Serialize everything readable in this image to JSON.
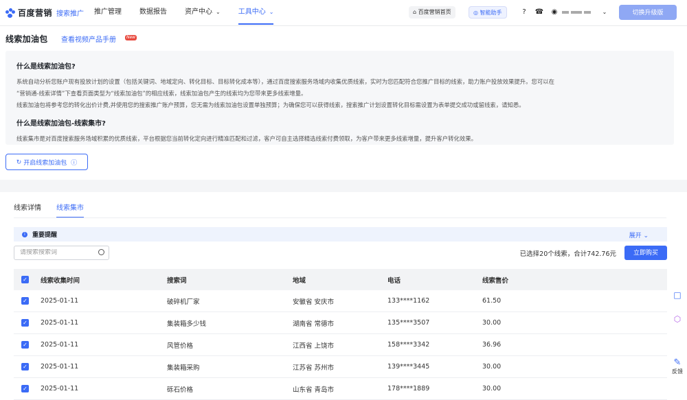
{
  "app": {
    "logo_text": "百度营销",
    "logo_sub": "搜索推广"
  },
  "nav": {
    "items": [
      {
        "label": "推广管理",
        "dropdown": false,
        "active": false
      },
      {
        "label": "数据报告",
        "dropdown": false,
        "active": false
      },
      {
        "label": "资产中心",
        "dropdown": true,
        "active": false
      },
      {
        "label": "工具中心",
        "dropdown": true,
        "active": true
      }
    ],
    "home_pill": "⌂ 百度营销首页",
    "assistant_pill": "◎ 智能助手",
    "upgrade_label": "切换升级版"
  },
  "page": {
    "title": "线索加油包",
    "manual_link": "查看视频产品手册",
    "new_badge": "New",
    "intro": {
      "q1": "什么是线索加油包?",
      "p1": "系统自动分析您账户现有投放计划的设置（包括关键词、地域定向、转化目标、目标转化成本等），通过百度搜索服务场域内收集优质线索，实时为您匹配符合您推广目标的线索，助力账户投放效果提升。您可以在",
      "p2": "“营销通-线索详情”下查看页面类型为“线索加油包”的相应线索，线索加油包产生的线索均为您带来更多线索增量。",
      "p3": "线索加油包将参考您的转化出价计费,并使用您的搜索推广账户预算，您无需为线索加油包设置单独预算；为确保您可以获得线索，搜索推广计划设置转化目标需设置为表单提交成功或留线索，请知悉。",
      "q2": "什么是线索加油包-线索集市?",
      "p4": "线索集市是对百度搜索服务场域积累的优质线索，平台根据您当前转化定向进行精准匹配和过滤，客户可自主选择精选线索付费领取，为客户带来更多线索增量，提升客户转化效果。"
    },
    "open_button": "开启线索加油包"
  },
  "tabs": [
    {
      "label": "线索详情",
      "active": false
    },
    {
      "label": "线索集市",
      "active": true
    }
  ],
  "notice": {
    "title": "重要提醒",
    "expand": "展开"
  },
  "search": {
    "placeholder": "请搜索搜索词"
  },
  "summary": "已选择20个线索，合计742.76元",
  "buy_button": "立即购买",
  "table": {
    "headers": [
      "线索收集时间",
      "搜索词",
      "地域",
      "电话",
      "线索售价"
    ],
    "rows": [
      {
        "date": "2025-01-11",
        "keyword": "破碎机厂家",
        "region": "安徽省 安庆市",
        "phone": "133****1162",
        "price": "61.50"
      },
      {
        "date": "2025-01-11",
        "keyword": "集装箱多少钱",
        "region": "湖南省 常德市",
        "phone": "135****3507",
        "price": "30.00"
      },
      {
        "date": "2025-01-11",
        "keyword": "风管价格",
        "region": "江西省 上饶市",
        "phone": "158****3342",
        "price": "36.96"
      },
      {
        "date": "2025-01-11",
        "keyword": "集装箱采购",
        "region": "江苏省 苏州市",
        "phone": "139****3445",
        "price": "30.00"
      },
      {
        "date": "2025-01-11",
        "keyword": "砾石价格",
        "region": "山东省 青岛市",
        "phone": "178****1889",
        "price": "30.00"
      }
    ]
  },
  "float_tools": {
    "feedback_label": "反馈"
  }
}
